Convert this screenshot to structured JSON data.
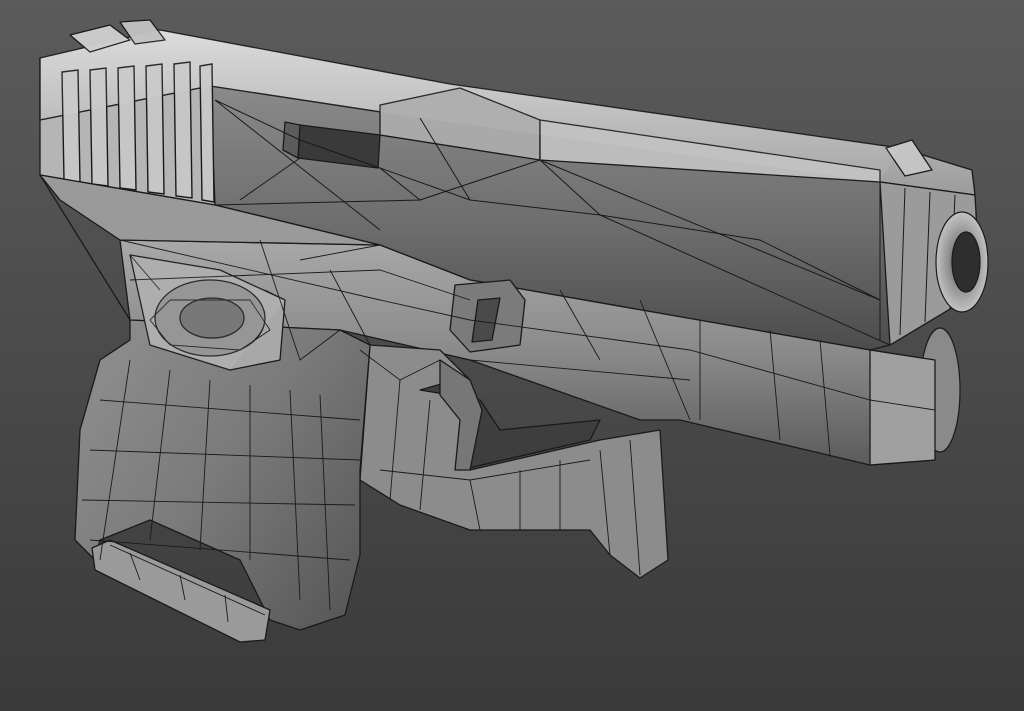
{
  "scene": {
    "subject": "pistol-wireframe-render",
    "colors": {
      "background_top": "#5a5a5a",
      "background_bottom": "#3b3b3b",
      "metal_light": "#cfcfcf",
      "metal_mid": "#8f8f8f",
      "metal_dark": "#4a4a4a",
      "wire": "#1a1a1a"
    }
  }
}
